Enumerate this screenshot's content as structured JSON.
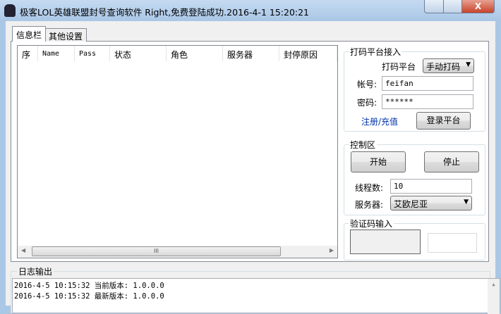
{
  "window": {
    "title": "极客LOL英雄联盟封号查询软件     Right,免费登陆成功.2016-4-1 15:20:21",
    "close_label": "X"
  },
  "tabs": [
    {
      "label": "信息栏"
    },
    {
      "label": "其他设置"
    }
  ],
  "list": {
    "columns": [
      "序",
      "Name",
      "Pass",
      "状态",
      "角色",
      "服务器",
      "封停原因"
    ],
    "scroll_grip": "III"
  },
  "platform": {
    "group_label": "打码平台接入",
    "platform_label": "打码平台",
    "platform_value": "手动打码",
    "account_label": "帐号:",
    "account_value": "feifan",
    "password_label": "密码:",
    "password_value": "******",
    "register_link": "注册/充值",
    "login_button": "登录平台"
  },
  "control": {
    "group_label": "控制区",
    "start_button": "开始",
    "stop_button": "停止",
    "threads_label": "线程数:",
    "threads_value": "10",
    "server_label": "服务器:",
    "server_value": "艾欧尼亚"
  },
  "captcha": {
    "group_label": "验证码输入"
  },
  "log": {
    "group_label": "日志输出",
    "lines": [
      "2016-4-5 10:15:32 当前版本: 1.0.0.0",
      "2016-4-5 10:15:32 最新版本: 1.0.0.0"
    ]
  }
}
